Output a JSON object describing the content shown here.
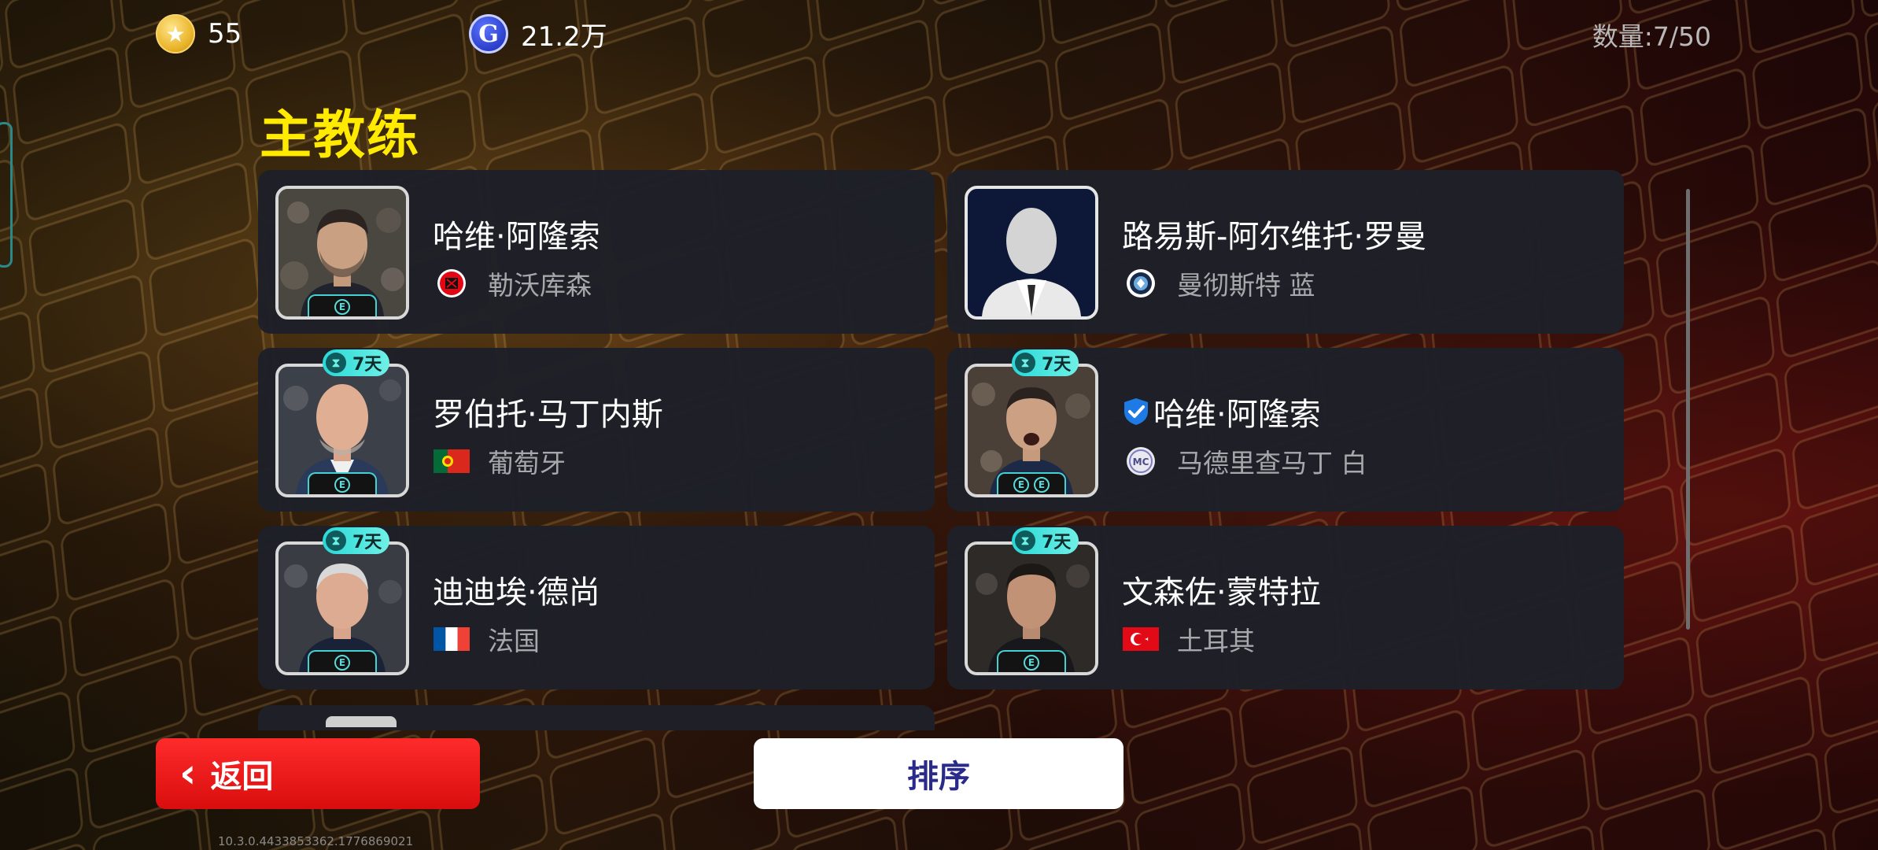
{
  "currency": {
    "coins_icon": "gold-star-coin",
    "coins_value": "55",
    "gp_icon": "gp-coin",
    "gp_symbol": "G",
    "gp_value": "21.2万"
  },
  "count_label": "数量:7/50",
  "page_title": "主教练",
  "coaches": [
    {
      "name": "哈维·阿隆索",
      "team": "勒沃库森",
      "team_icon": "leverkusen-crest",
      "timer": null,
      "verified": false,
      "badges": 1,
      "portrait": "photo"
    },
    {
      "name": "路易斯-阿尔维托·罗曼",
      "team": "曼彻斯特 蓝",
      "team_icon": "manchester-blue-crest",
      "timer": null,
      "verified": false,
      "badges": 0,
      "portrait": "silhouette"
    },
    {
      "name": "罗伯托·马丁内斯",
      "team": "葡萄牙",
      "team_icon": "portugal-flag",
      "timer": "7天",
      "verified": false,
      "badges": 1,
      "portrait": "photo"
    },
    {
      "name": "哈维·阿隆索",
      "team": "马德里查马丁 白",
      "team_icon": "madrid-white-crest",
      "timer": "7天",
      "verified": true,
      "badges": 2,
      "portrait": "photo"
    },
    {
      "name": "迪迪埃·德尚",
      "team": "法国",
      "team_icon": "france-flag",
      "timer": "7天",
      "verified": false,
      "badges": 1,
      "portrait": "photo"
    },
    {
      "name": "文森佐·蒙特拉",
      "team": "土耳其",
      "team_icon": "turkey-flag",
      "timer": "7天",
      "verified": false,
      "badges": 1,
      "portrait": "photo"
    }
  ],
  "badge_symbol": "E",
  "buttons": {
    "back": "返回",
    "sort": "排序"
  },
  "version": "10.3.0.4433853362.1776869021",
  "colors": {
    "title": "#ffea00",
    "back_button": "#e61414",
    "timer_badge": "#2ad8d8",
    "card": "#1e2028"
  }
}
